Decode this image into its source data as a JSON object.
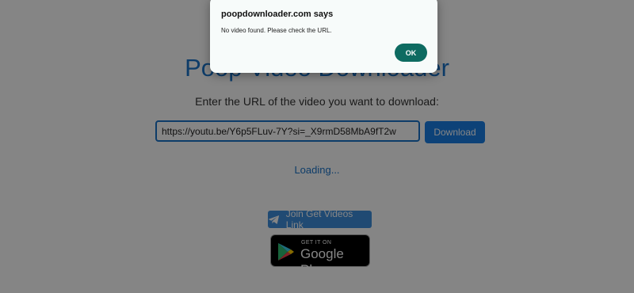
{
  "page": {
    "title": "Poop Video Downloader",
    "prompt": "Enter the URL of the video you want to download:",
    "url_value": "https://youtu.be/Y6p5FLuv-7Y?si=_X9rmD58MbA9fT2w",
    "download_label": "Download",
    "loading_text": "Loading...",
    "telegram_label": "Join Get Videos Link",
    "telegram_icon": "telegram-icon",
    "badge_small": "GET IT ON",
    "badge_big": "Google Play",
    "badge_icon": "google-play-icon",
    "colors": {
      "accent": "#1a73c9",
      "button": "#1a7fe6",
      "ok": "#0e6b61"
    }
  },
  "dialog": {
    "title": "poopdownloader.com says",
    "message": "No video found. Please check the URL.",
    "ok_label": "OK"
  }
}
